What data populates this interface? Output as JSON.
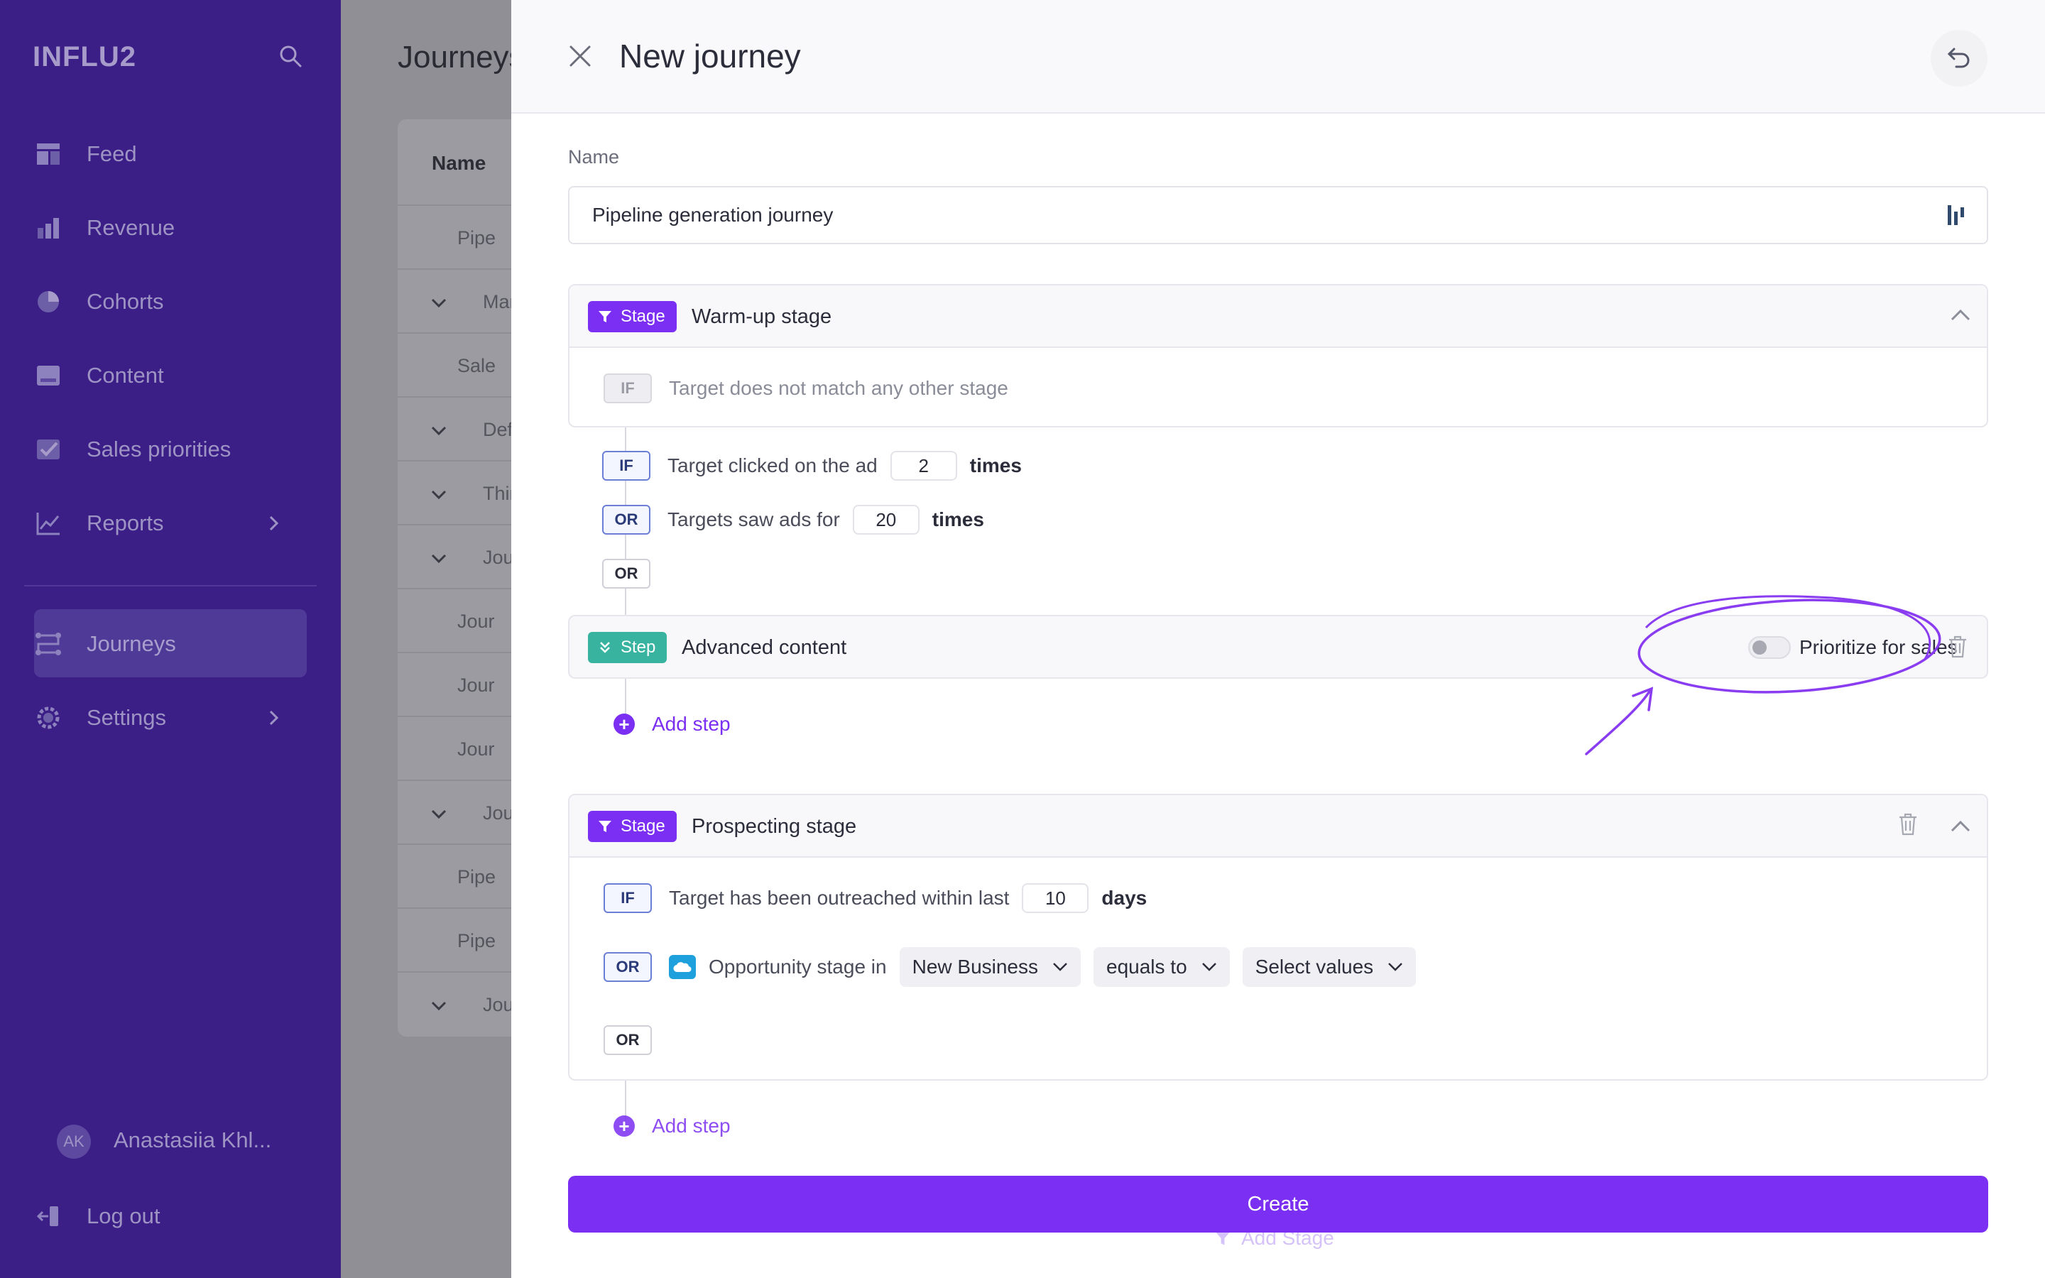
{
  "app": {
    "logo": "INFLU2"
  },
  "sidebar": {
    "items": [
      {
        "label": "Feed",
        "icon": "feed-icon"
      },
      {
        "label": "Revenue",
        "icon": "revenue-icon"
      },
      {
        "label": "Cohorts",
        "icon": "cohorts-icon"
      },
      {
        "label": "Content",
        "icon": "content-icon"
      },
      {
        "label": "Sales priorities",
        "icon": "checkmark-icon"
      },
      {
        "label": "Reports",
        "icon": "reports-icon"
      },
      {
        "label": "Journeys",
        "icon": "journeys-icon",
        "active": true
      },
      {
        "label": "Settings",
        "icon": "gear-icon"
      }
    ],
    "user": {
      "initials": "AK",
      "name": "Anastasiia Khl..."
    },
    "logout_label": "Log out"
  },
  "background_page": {
    "title": "Journeys",
    "column_name": "Name",
    "rows": [
      "Pipe",
      "Mark",
      "Sale",
      "Defa",
      "Third",
      "Jour",
      "Jour",
      "Jour",
      "Jour",
      "Jour",
      "Pipe",
      "Pipe",
      "Jour"
    ]
  },
  "modal": {
    "title": "New journey",
    "name_label": "Name",
    "name_value": "Pipeline generation journey",
    "stage1": {
      "badge": "Stage",
      "title": "Warm-up stage",
      "if_tag": "IF",
      "if_text": "Target does not match any other stage"
    },
    "conditions": [
      {
        "tag": "IF",
        "text": "Target clicked on the ad",
        "value": "2",
        "unit": "times"
      },
      {
        "tag": "OR",
        "text": "Targets saw ads for",
        "value": "20",
        "unit": "times"
      }
    ],
    "or_tag": "OR",
    "step": {
      "badge": "Step",
      "title": "Advanced content",
      "toggle_label": "Prioritize for sales"
    },
    "add_step_label": "Add step",
    "stage2": {
      "badge": "Stage",
      "title": "Prospecting stage",
      "if_tag": "IF",
      "if_text": "Target has been outreached within last",
      "if_value": "10",
      "if_unit": "days",
      "or_tag": "OR",
      "or_text": "Opportunity stage in",
      "select1": "New Business",
      "select2": "equals to",
      "select3": "Select values",
      "or2_tag": "OR"
    },
    "add_step2_label": "Add step",
    "create_label": "Create",
    "add_stage_label": "Add Stage"
  },
  "colors": {
    "sidebar_bg": "#3c1e87",
    "accent": "#7b2ff2",
    "step_badge": "#37b3a0",
    "annotation": "#8a3cf0"
  }
}
